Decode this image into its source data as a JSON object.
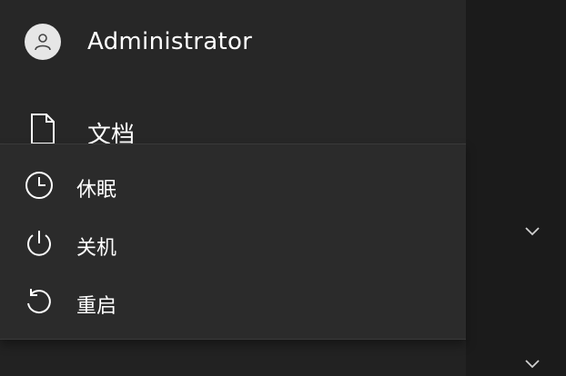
{
  "user": {
    "name": "Administrator",
    "avatar_icon": "person-icon"
  },
  "folders": [
    {
      "label": "文档",
      "icon": "document-icon"
    }
  ],
  "power_menu": {
    "items": [
      {
        "label": "休眠",
        "icon": "clock-icon"
      },
      {
        "label": "关机",
        "icon": "power-icon"
      },
      {
        "label": "重启",
        "icon": "restart-icon"
      }
    ]
  },
  "right_pane": {
    "expand_icons": [
      "chevron-down-icon",
      "chevron-down-icon"
    ]
  },
  "colors": {
    "panel": "#272727",
    "menu": "#2b2b2b",
    "background": "#1b1b1b",
    "text": "#ffffff"
  }
}
